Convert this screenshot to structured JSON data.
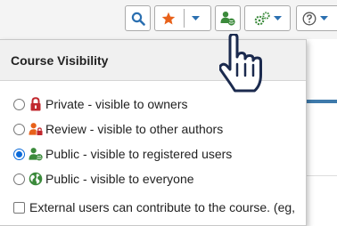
{
  "toolbar": {
    "buttons": [
      {
        "name": "search",
        "icon": "search-icon",
        "color": "#2a6fb0"
      },
      {
        "name": "favorite",
        "icon": "star-icon",
        "color": "#e8611a"
      },
      {
        "name": "visibility",
        "icon": "user-globe-icon",
        "color": "#3b8a3b"
      },
      {
        "name": "settings",
        "icon": "gears-icon",
        "color": "#3b8a3b"
      },
      {
        "name": "help",
        "icon": "question-circle-icon",
        "color": "#555555"
      }
    ]
  },
  "dropdown": {
    "title": "Course Visibility",
    "options": [
      {
        "label": "Private - visible to owners",
        "icon": "lock-icon",
        "color": "#c1272d",
        "selected": false
      },
      {
        "label": "Review - visible to other authors",
        "icon": "user-lock-icon",
        "color": "#e8611a",
        "selected": false
      },
      {
        "label": "Public - visible to registered users",
        "icon": "user-globe-icon",
        "color": "#3b8a3b",
        "selected": true
      },
      {
        "label": "Public - visible to everyone",
        "icon": "globe-icon",
        "color": "#3b8a3b",
        "selected": false
      }
    ],
    "external_contrib": {
      "label": "External users can contribute to the course. (eg,",
      "checked": false
    }
  },
  "colors": {
    "accent": "#0b6ad9",
    "page_rule": "#3e7aab"
  }
}
